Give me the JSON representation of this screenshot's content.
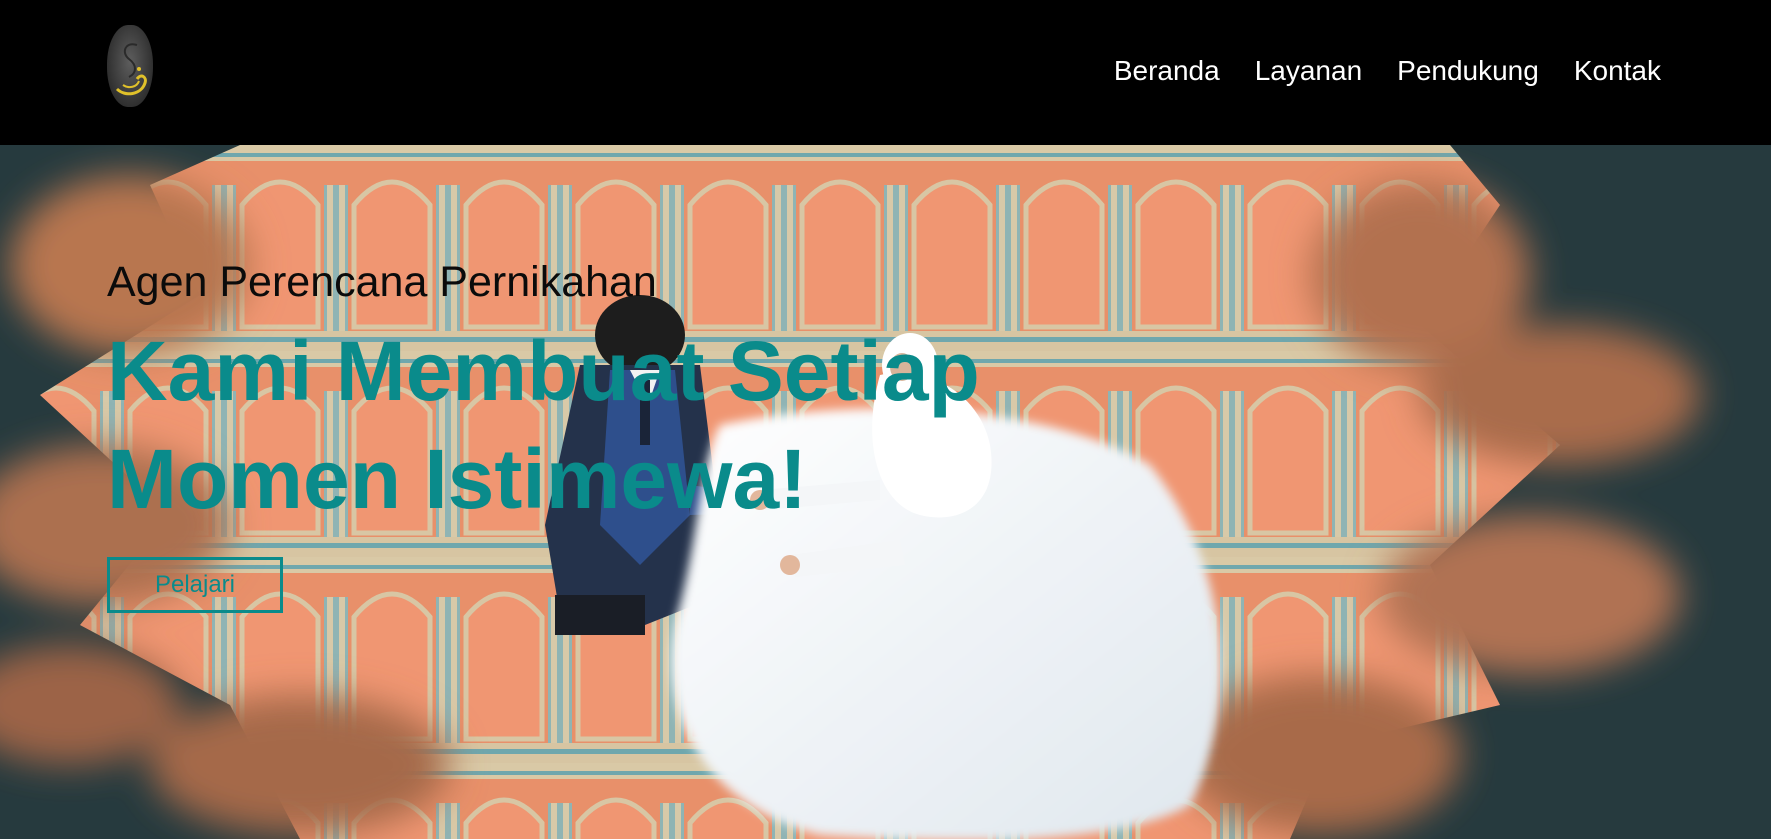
{
  "brand": {
    "logo_icon": "swan-monogram-icon",
    "logo_color": "#e0c12a"
  },
  "nav": {
    "items": [
      {
        "label": "Beranda"
      },
      {
        "label": "Layanan"
      },
      {
        "label": "Pendukung"
      },
      {
        "label": "Kontak"
      }
    ]
  },
  "hero": {
    "tagline": "Agen Perencana Pernikahan",
    "headline": "Kami Membuat Setiap Momen Istimewa!",
    "cta_label": "Pelajari",
    "image": "wedding-couple-on-carpet-photo",
    "colors": {
      "accent": "#0a8b8b",
      "background": "#263a3e",
      "carpet": "#e8906a",
      "navbar": "#000000"
    }
  }
}
